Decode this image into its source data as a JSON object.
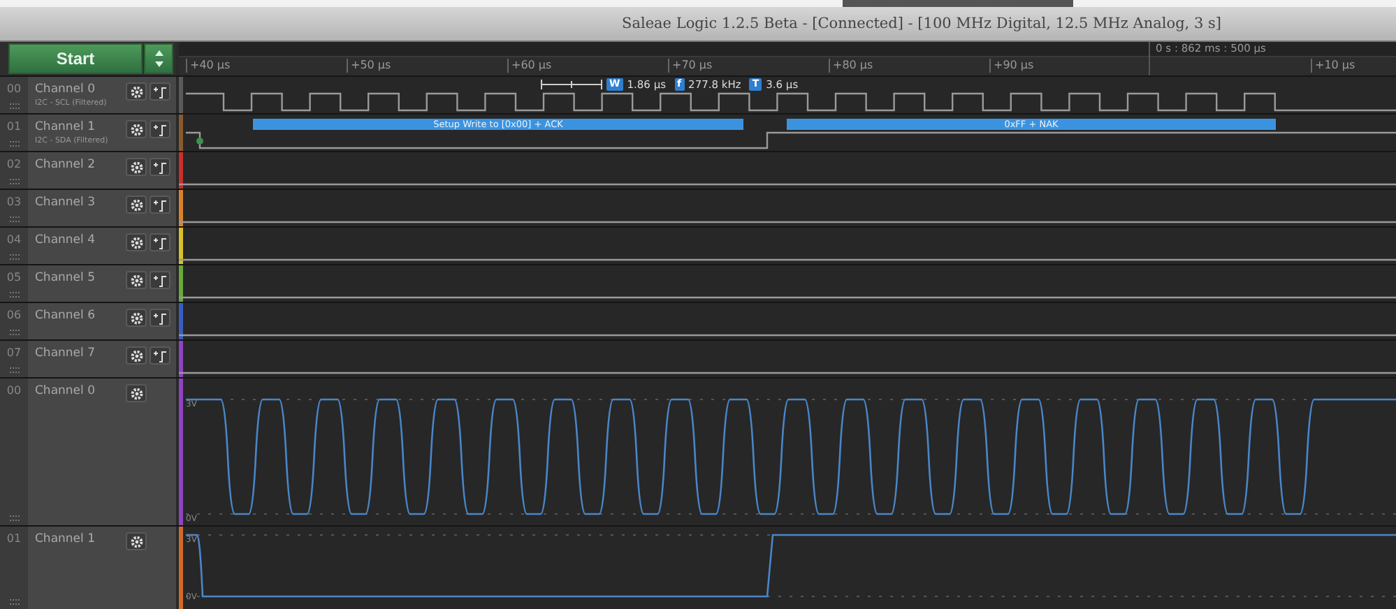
{
  "window": {
    "title": "Saleae Logic 1.2.5 Beta - [Connected] - [100 MHz Digital, 12.5 MHz Analog, 3 s]"
  },
  "start_button": {
    "label": "Start"
  },
  "ruler": {
    "ticks": [
      "+40 µs",
      "+50 µs",
      "+60 µs",
      "+70 µs",
      "+80 µs",
      "+90 µs",
      "+10 µs"
    ],
    "marker": "0 s : 862 ms : 500 µs"
  },
  "measurement": [
    {
      "badge": "W",
      "value": "1.86 µs"
    },
    {
      "badge": "f",
      "value": "277.8 kHz"
    },
    {
      "badge": "T",
      "value": "3.6 µs"
    }
  ],
  "digital_channels": [
    {
      "number": "00",
      "name": "Channel 0",
      "analyzer": "I2C - SCL (Filtered)",
      "color": "#5a5a5a",
      "kind": "clock"
    },
    {
      "number": "01",
      "name": "Channel 1",
      "analyzer": "I2C - SDA (Filtered)",
      "color": "#8a5a2e",
      "kind": "data",
      "annotations": [
        "Setup Write to [0x00] + ACK",
        "0xFF + NAK"
      ]
    },
    {
      "number": "02",
      "name": "Channel 2",
      "color": "#c8302c",
      "kind": "idle"
    },
    {
      "number": "03",
      "name": "Channel 3",
      "color": "#d9822b",
      "kind": "idle"
    },
    {
      "number": "04",
      "name": "Channel 4",
      "color": "#d8c02a",
      "kind": "idle"
    },
    {
      "number": "05",
      "name": "Channel 5",
      "color": "#6aa83a",
      "kind": "idle"
    },
    {
      "number": "06",
      "name": "Channel 6",
      "color": "#3a5ec0",
      "kind": "idle"
    },
    {
      "number": "07",
      "name": "Channel 7",
      "color": "#8e44c0",
      "kind": "idle"
    }
  ],
  "analog_channels": [
    {
      "number": "00",
      "name": "Channel 0",
      "color": "#8e44c0",
      "kind": "clock",
      "high_label": "3V",
      "low_label": "0V"
    },
    {
      "number": "01",
      "name": "Channel 1",
      "color": "#d06a2a",
      "kind": "data",
      "high_label": "3V",
      "low_label": "0V"
    }
  ]
}
